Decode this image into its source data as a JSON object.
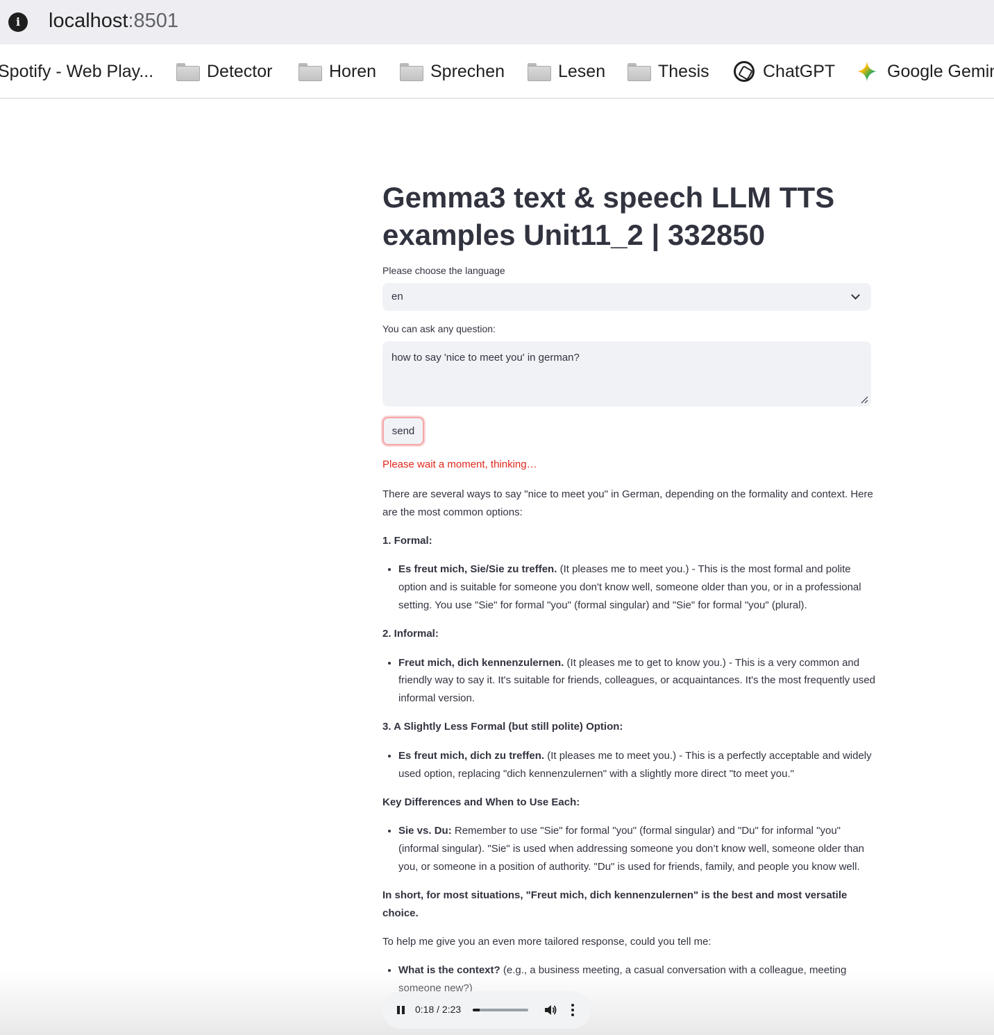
{
  "browser": {
    "url_host": "localhost",
    "url_port": ":8501",
    "bookmarks": [
      {
        "label": "Spotify - Web Play...",
        "icon": "spotify-icon"
      },
      {
        "label": "Detector",
        "icon": "folder-icon"
      },
      {
        "label": "Horen",
        "icon": "folder-icon"
      },
      {
        "label": "Sprechen",
        "icon": "folder-icon"
      },
      {
        "label": "Lesen",
        "icon": "folder-icon"
      },
      {
        "label": "Thesis",
        "icon": "folder-icon"
      },
      {
        "label": "ChatGPT",
        "icon": "chatgpt-icon"
      },
      {
        "label": "Google Gemini",
        "icon": "gemini-icon"
      }
    ]
  },
  "app": {
    "title": "Gemma3 text & speech LLM TTS examples Unit11_2 | 332850",
    "language_label": "Please choose the language",
    "language_value": "en",
    "question_label": "You can ask any question:",
    "question_value": "how to say 'nice to meet you' in german?",
    "send_label": "send",
    "status": "Please wait a moment, thinking…",
    "status_color": "#e0281c"
  },
  "answer": {
    "intro": "There are several ways to say \"nice to meet you\" in German, depending on the formality and context. Here are the most common options:",
    "h1": "1. Formal:",
    "b1_bold": "Es freut mich, Sie/Sie zu treffen.",
    "b1_text": " (It pleases me to meet you.) - This is the most formal and polite option and is suitable for someone you don't know well, someone older than you, or in a professional setting. You use \"Sie\" for formal \"you\" (formal singular) and \"Sie\" for formal \"you\" (plural).",
    "h2": "2. Informal:",
    "b2_bold": "Freut mich, dich kennenzulernen.",
    "b2_text": " (It pleases me to get to know you.) - This is a very common and friendly way to say it. It's suitable for friends, colleagues, or acquaintances. It's the most frequently used informal version.",
    "h3": "3. A Slightly Less Formal (but still polite) Option:",
    "b3_bold": "Es freut mich, dich zu treffen.",
    "b3_text": " (It pleases me to meet you.) - This is a perfectly acceptable and widely used option, replacing \"dich kennenzulernen\" with a slightly more direct \"to meet you.\"",
    "h4": "Key Differences and When to Use Each:",
    "b4_bold": "Sie vs. Du:",
    "b4_text": " Remember to use \"Sie\" for formal \"you\" (formal singular) and \"Du\" for informal \"you\" (informal singular). \"Sie\" is used when addressing someone you don’t know well, someone older than you, or someone in a position of authority. \"Du\" is used for friends, family, and people you know well.",
    "summary": "In short, for most situations, \"Freut mich, dich kennenzulernen\" is the best and most versatile choice.",
    "followup": "To help me give you an even more tailored response, could you tell me:",
    "b5_bold": "What is the context?",
    "b5_text": " (e.g., a business meeting, a casual conversation with a colleague, meeting someone new?)"
  },
  "audio": {
    "time": "0:18 / 2:23",
    "progress": 0.126
  }
}
